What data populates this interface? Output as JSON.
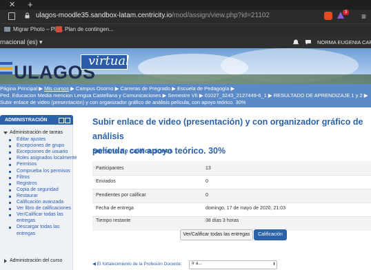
{
  "browser": {
    "url_host": "ulagos-moodle35.sandbox-latam.centricity.io",
    "url_path": "/mod/assign/view.php?id=21102",
    "bookmarks": [
      "Migrar Photo – Pla...",
      "Plan de contingen..."
    ],
    "extension_badge": "3"
  },
  "topnav": {
    "language": "rnacional (es) ▾",
    "user_name": "NORMA EUGENIA CARDEN"
  },
  "banner": {
    "logo_word": "ULAGOS",
    "logo_tag": "virtual"
  },
  "breadcrumb": {
    "line1": [
      "Página Principal",
      "Mis cursos",
      "Campus Osorno",
      "Carreras de Pregrado",
      "Escuela de Pedagogía"
    ],
    "line2": [
      "Ped. Educacion Media mencion Lengua Castellana y Comunicaciones",
      "Semestre VII",
      "01027_3243_2127449-6_1",
      "RESULTADO DE APRENDIZAJE 1 y 2"
    ],
    "line3": "Subir enlace de video (presentación) y con organizador gráfico de análisis película, con apoyo teórico. 30%"
  },
  "sidebar": {
    "title": "ADMINISTRACIÓN",
    "section1": "Administración de tareas",
    "items": [
      "Editar ajustes",
      "Excepciones de grupo",
      "Excepciones de usuario",
      "Roles asignados localmente",
      "Permisos",
      "Comprueba los permisos",
      "Filtros",
      "Registros",
      "Copia de seguridad",
      "Restaurar",
      "Calificación avanzada",
      "Ver libro de calificaciones",
      "Ver/Calificar todas las",
      "entregas",
      "Descargar todas las",
      "entregas"
    ],
    "section2": "Administración del curso"
  },
  "main": {
    "title_line1": "Subir enlace de video (presentación) y con organizador gráfico de análisis",
    "title_line2": "película, con apoyo teórico. 30%",
    "summary_title": "Sumario de calificaciones",
    "rows": [
      {
        "label": "Participantes",
        "value": "13"
      },
      {
        "label": "Enviados",
        "value": "0"
      },
      {
        "label": "Pendientes por calificar",
        "value": "0"
      },
      {
        "label": "Fecha de entrega",
        "value": "domingo, 17 de mayo de 2020, 21:03"
      },
      {
        "label": "Tiempo restante",
        "value": "38 días 3 horas"
      }
    ],
    "btn_view_all": "Ver/Calificar todas las entregas",
    "btn_grade": "Calificación",
    "prev_activity": "◀ El fortalecimiento de la Profesión Docente:",
    "goto_placeholder": "Ir a..."
  }
}
